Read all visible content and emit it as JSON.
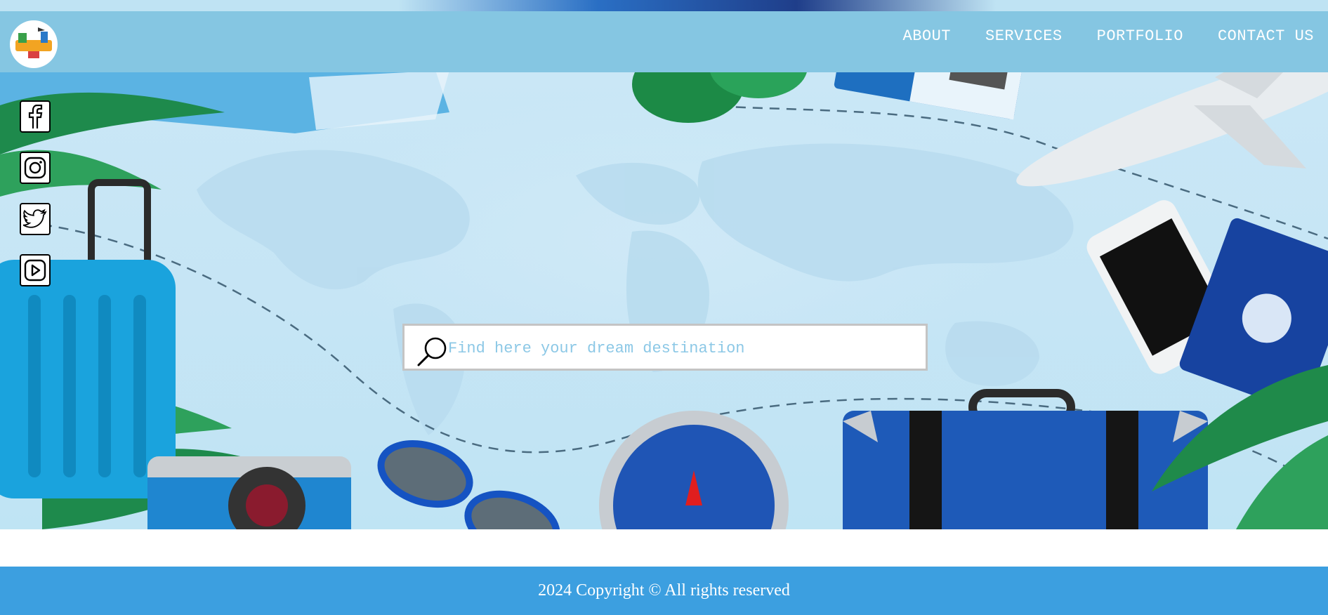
{
  "brand": {
    "logo_icon": "travel-buddies-logo-icon"
  },
  "nav": {
    "items": [
      {
        "label": "ABOUT"
      },
      {
        "label": "SERVICES"
      },
      {
        "label": "PORTFOLIO"
      },
      {
        "label": "CONTACT US"
      }
    ]
  },
  "social": [
    {
      "icon": "facebook-icon"
    },
    {
      "icon": "instagram-icon"
    },
    {
      "icon": "twitter-icon"
    },
    {
      "icon": "youtube-icon"
    }
  ],
  "search": {
    "placeholder": "Find here your dream destination",
    "value": "",
    "icon": "search-icon"
  },
  "footer": {
    "copyright": "2024 Copyright © All rights reserved"
  },
  "colors": {
    "navbar": "#85c6e2",
    "footer": "#3c9fe0",
    "hero": "#c6e5f5",
    "placeholder": "#8cc8e6"
  }
}
